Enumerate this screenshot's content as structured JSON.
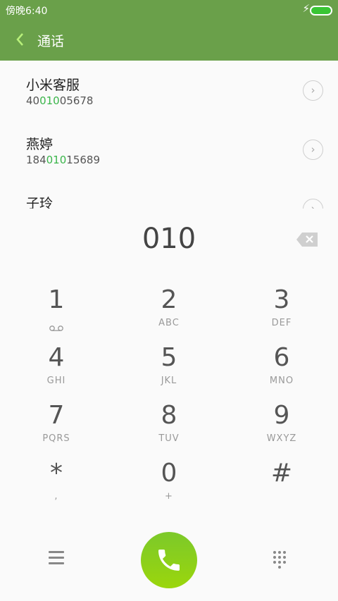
{
  "status": {
    "time": "傍晚6:40"
  },
  "appbar": {
    "title": "通话",
    "back_icon": "chevron-left-icon"
  },
  "contacts": [
    {
      "name": "小米客服",
      "number_prefix": "40",
      "number_match": "010",
      "number_suffix": "05678"
    },
    {
      "name": "燕婷",
      "number_prefix": "184",
      "number_match": "010",
      "number_suffix": "15689"
    },
    {
      "name": "子玲",
      "number_prefix": "",
      "number_match": "",
      "number_suffix": ""
    }
  ],
  "dialpad": {
    "input": "010",
    "keys": [
      {
        "digit": "1",
        "sub": ""
      },
      {
        "digit": "2",
        "sub": "ABC"
      },
      {
        "digit": "3",
        "sub": "DEF"
      },
      {
        "digit": "4",
        "sub": "GHI"
      },
      {
        "digit": "5",
        "sub": "JKL"
      },
      {
        "digit": "6",
        "sub": "MNO"
      },
      {
        "digit": "7",
        "sub": "PQRS"
      },
      {
        "digit": "8",
        "sub": "TUV"
      },
      {
        "digit": "9",
        "sub": "WXYZ"
      },
      {
        "digit": "*",
        "sub": ","
      },
      {
        "digit": "0",
        "sub": "+"
      },
      {
        "digit": "#",
        "sub": ""
      }
    ]
  },
  "colors": {
    "accent": "#6aa04a",
    "match": "#3ab54a",
    "call": "#8ccf1a"
  }
}
